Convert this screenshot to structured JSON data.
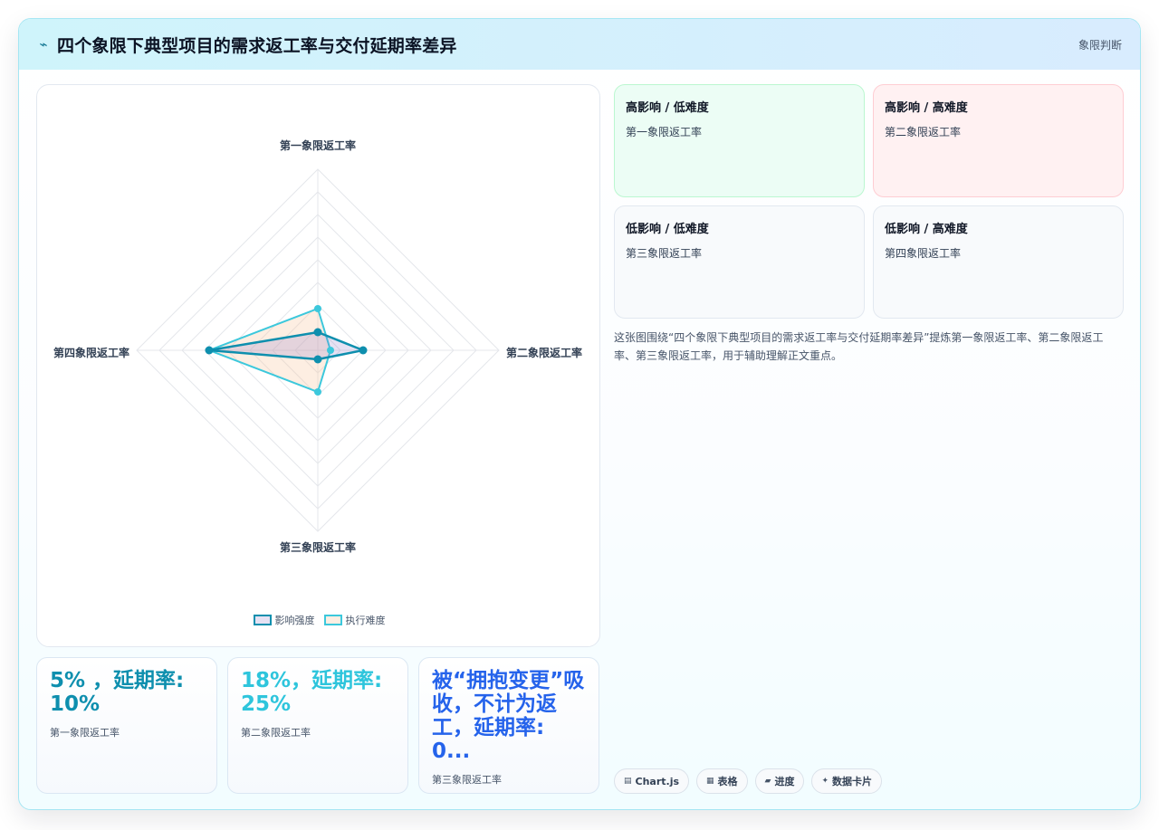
{
  "header": {
    "icon": "bolt-icon",
    "title": "四个象限下典型项目的需求返工率与交付延期率差异",
    "tag": "象限判断"
  },
  "colors": {
    "impact": "#0e8fae",
    "difficulty": "#3cc8dc",
    "impact_fill": "rgba(139,120,200,0.22)",
    "difficulty_fill": "rgba(250,200,160,0.30)",
    "stat1": "#0e8fae",
    "stat2": "#2ec5dc",
    "stat3": "#2563eb",
    "quad_green": "#ecfdf5",
    "quad_red": "#fff1f2",
    "quad_gray": "#f8fafc"
  },
  "chart_data": {
    "type": "radar",
    "axes": [
      "第一象限返工率",
      "第二象限返工率",
      "第三象限返工率",
      "第四象限返工率"
    ],
    "scale": {
      "min": 0,
      "max": 100,
      "rings": 8,
      "grid": true,
      "ticks_shown": false
    },
    "series": [
      {
        "name": "影响强度",
        "values": [
          10,
          25,
          5,
          60
        ]
      },
      {
        "name": "执行难度",
        "values": [
          23,
          7,
          23,
          60
        ]
      }
    ],
    "legend_position": "bottom-center"
  },
  "stats": [
    {
      "value": "5% ，延期率: 10%",
      "label": "第一象限返工率"
    },
    {
      "value": "18%，延期率: 25%",
      "label": "第二象限返工率"
    },
    {
      "value": "被“拥抱变更”吸收，不计为返工，延期率: 0...",
      "label": "第三象限返工率"
    }
  ],
  "quadrants": [
    {
      "title": "高影响 / 低难度",
      "sub": "第一象限返工率"
    },
    {
      "title": "高影响 / 高难度",
      "sub": "第二象限返工率"
    },
    {
      "title": "低影响 / 低难度",
      "sub": "第三象限返工率"
    },
    {
      "title": "低影响 / 高难度",
      "sub": "第四象限返工率"
    }
  ],
  "description": "这张图围绕“四个象限下典型项目的需求返工率与交付延期率差异”提炼第一象限返工率、第二象限返工率、第三象限返工率，用于辅助理解正文重点。",
  "chips": [
    {
      "icon": "chart-icon",
      "label": "Chart.js"
    },
    {
      "icon": "table-icon",
      "label": "表格"
    },
    {
      "icon": "progress-icon",
      "label": "进度"
    },
    {
      "icon": "sparkle-icon",
      "label": "数据卡片"
    }
  ]
}
